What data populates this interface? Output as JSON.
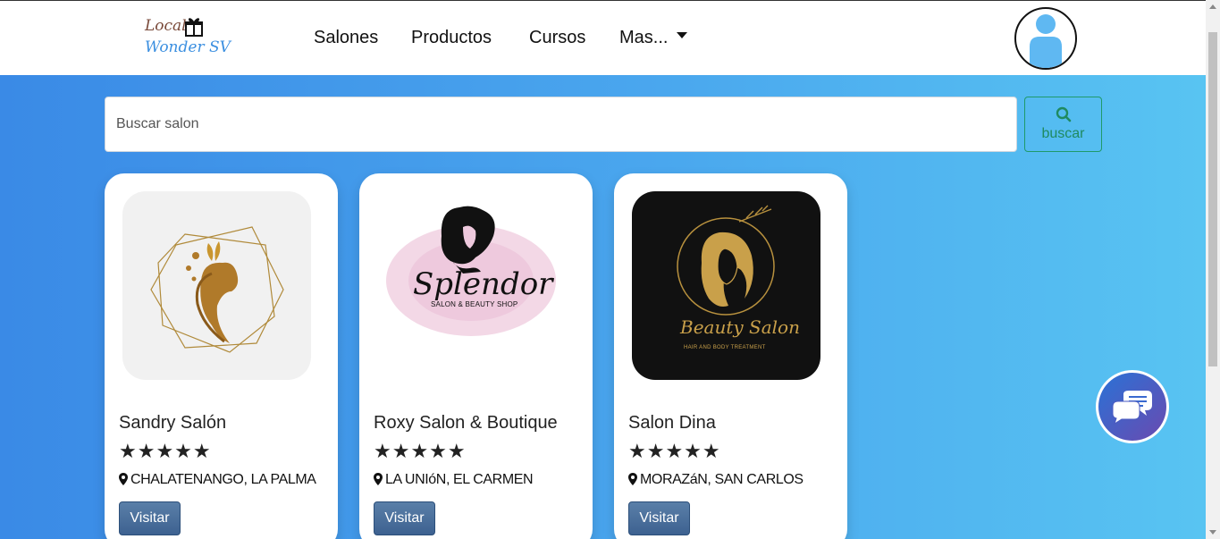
{
  "brand": {
    "line1": "Local",
    "line2": "Wonder SV"
  },
  "nav": {
    "items": [
      {
        "label": "Salones"
      },
      {
        "label": "Productos"
      },
      {
        "label": "Cursos"
      },
      {
        "label": "Mas..."
      }
    ]
  },
  "search": {
    "placeholder": "Buscar salon",
    "button_label": "buscar"
  },
  "salons": [
    {
      "name": "Sandry Salón",
      "rating": 5,
      "stars": "★★★★★",
      "location": "CHALATENANGO, LA PALMA",
      "button": "Visitar"
    },
    {
      "name": "Roxy Salon & Boutique",
      "rating": 5,
      "stars": "★★★★★",
      "location": "LA UNIóN, EL CARMEN",
      "button": "Visitar",
      "logo_text": "Splendor",
      "logo_subtext": "SALON & BEAUTY SHOP"
    },
    {
      "name": "Salon Dina",
      "rating": 5,
      "stars": "★★★★★",
      "location": "MORAZáN, SAN CARLOS",
      "button": "Visitar",
      "logo_text": "Beauty Salon",
      "logo_subtext": "HAIR AND BODY TREATMENT"
    }
  ],
  "colors": {
    "accent": "#3a8ae6",
    "search_button": "#1f8a60",
    "visit_button": "#3d6190"
  },
  "icons": [
    "gift-icon",
    "user-icon",
    "search-icon",
    "location-pin-icon",
    "chat-icon"
  ]
}
